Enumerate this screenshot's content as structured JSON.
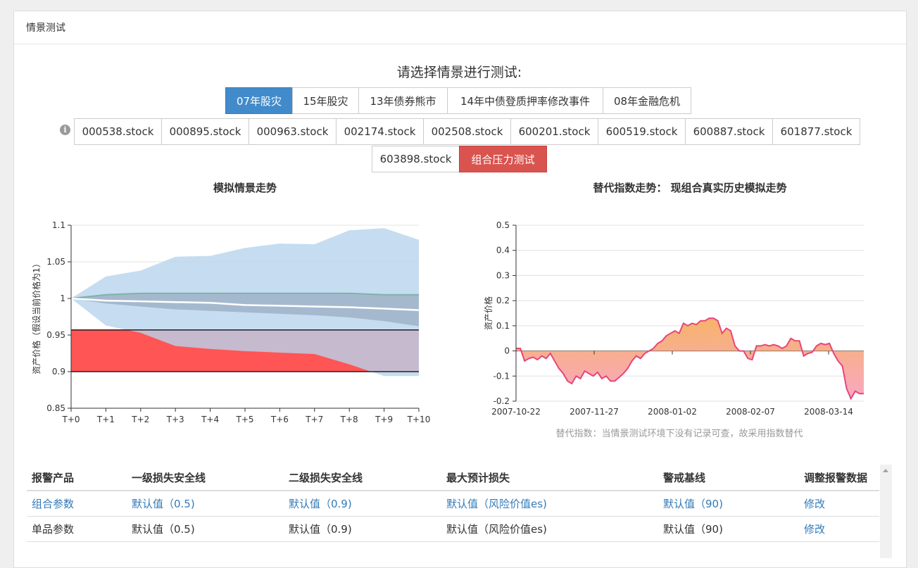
{
  "panel": {
    "title": "情景测试"
  },
  "prompt": "请选择情景进行测试:",
  "scenarios": [
    {
      "label": "07年股灾",
      "active": true
    },
    {
      "label": "15年股灾",
      "active": false
    },
    {
      "label": "13年债券熊市",
      "active": false
    },
    {
      "label": "14年中债登质押率修改事件",
      "active": false
    },
    {
      "label": "08年金融危机",
      "active": false
    }
  ],
  "stocks": [
    "000538.stock",
    "000895.stock",
    "000963.stock",
    "002174.stock",
    "002508.stock",
    "600201.stock",
    "600519.stock",
    "600887.stock",
    "601877.stock",
    "603898.stock"
  ],
  "stress_button": "组合压力测试",
  "info_icon": "i",
  "left_chart_title": "模拟情景走势",
  "right_chart_title": "替代指数走势： 现组合真实历史模拟走势",
  "right_chart_caption": "替代指数：当情景测试环境下没有记录可查，故采用指数替代",
  "chart_data": [
    {
      "type": "area",
      "title": "模拟情景走势",
      "ylabel": "资产价格（假设当前价格为1）",
      "categories": [
        "T+0",
        "T+1",
        "T+2",
        "T+3",
        "T+4",
        "T+5",
        "T+6",
        "T+7",
        "T+8",
        "T+9",
        "T+10"
      ],
      "ylim": [
        0.85,
        1.1
      ],
      "yticks": [
        "0.85",
        "0.9",
        "0.95",
        "1",
        "1.05",
        "1.1"
      ],
      "series": [
        {
          "role": "outer_upper",
          "values": [
            1.0,
            1.03,
            1.038,
            1.057,
            1.058,
            1.069,
            1.075,
            1.074,
            1.093,
            1.096,
            1.08
          ]
        },
        {
          "role": "outer_lower",
          "values": [
            1.0,
            0.963,
            0.953,
            0.935,
            0.931,
            0.928,
            0.926,
            0.924,
            0.91,
            0.894,
            0.894
          ]
        },
        {
          "role": "inner_upper",
          "values": [
            1.0,
            1.005,
            1.007,
            1.007,
            1.007,
            1.007,
            1.007,
            1.007,
            1.007,
            1.005,
            1.005
          ]
        },
        {
          "role": "inner_lower",
          "values": [
            1.0,
            0.993,
            0.989,
            0.985,
            0.983,
            0.981,
            0.979,
            0.977,
            0.974,
            0.969,
            0.962
          ]
        },
        {
          "role": "median",
          "values": [
            1.0,
            0.997,
            0.996,
            0.995,
            0.994,
            0.991,
            0.99,
            0.989,
            0.988,
            0.986,
            0.984
          ]
        }
      ],
      "loss_band": {
        "from": 0.9,
        "to": 0.957
      },
      "colors": {
        "outer": "#b8d3ec",
        "inner": "#9fb3c8",
        "loss": "#ff5555",
        "median": "#ffffff"
      }
    },
    {
      "type": "area",
      "title": "替代指数走势： 现组合真实历史模拟走势",
      "ylabel": "资产价格",
      "xticks": [
        "2007-10-22",
        "2007-11-27",
        "2008-01-02",
        "2008-02-07",
        "2008-03-14"
      ],
      "ylim": [
        -0.2,
        0.5
      ],
      "yticks": [
        "-0.2",
        "-0.1",
        "0",
        "0.1",
        "0.2",
        "0.3",
        "0.4",
        "0.5"
      ],
      "values": [
        0.01,
        0.01,
        -0.04,
        -0.03,
        -0.025,
        -0.035,
        -0.02,
        -0.03,
        -0.01,
        -0.04,
        -0.07,
        -0.09,
        -0.12,
        -0.13,
        -0.1,
        -0.11,
        -0.08,
        -0.09,
        -0.1,
        -0.085,
        -0.11,
        -0.1,
        -0.12,
        -0.12,
        -0.105,
        -0.09,
        -0.07,
        -0.04,
        -0.02,
        -0.03,
        -0.01,
        0.0,
        0.01,
        0.03,
        0.04,
        0.06,
        0.07,
        0.08,
        0.07,
        0.11,
        0.1,
        0.11,
        0.105,
        0.12,
        0.12,
        0.13,
        0.13,
        0.12,
        0.07,
        0.09,
        0.08,
        0.02,
        0.0,
        0.0,
        -0.03,
        -0.035,
        0.02,
        0.02,
        0.025,
        0.02,
        0.025,
        0.02,
        0.01,
        0.02,
        0.05,
        0.04,
        0.04,
        -0.02,
        -0.01,
        -0.005,
        0.02,
        0.03,
        0.025,
        0.03,
        -0.01,
        -0.04,
        -0.06,
        -0.15,
        -0.19,
        -0.16,
        -0.17,
        -0.17
      ],
      "colors": {
        "line": "#e8457a",
        "top": "#f7b36a",
        "bottom": "#f8a8c2"
      }
    }
  ],
  "table": {
    "headers": [
      "报警产品",
      "一级损失安全线",
      "二级损失安全线",
      "最大预计损失",
      "警戒基线",
      "调整报警数据"
    ],
    "rows": [
      {
        "name": "组合参数",
        "l1": "默认值（0.5)",
        "l2": "默认值（0.9)",
        "max": "默认值（风险价值es)",
        "base": "默认值（90)",
        "action": "修改",
        "linked": true
      },
      {
        "name": "单品参数",
        "l1": "默认值（0.5)",
        "l2": "默认值（0.9)",
        "max": "默认值（风险价值es)",
        "base": "默认值（90)",
        "action": "修改",
        "linked": false
      }
    ]
  }
}
